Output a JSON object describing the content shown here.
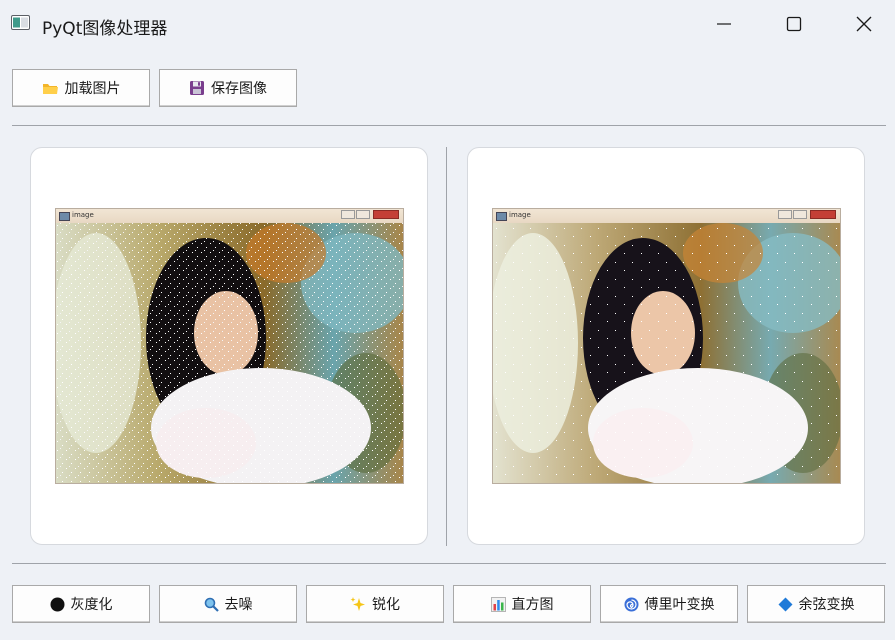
{
  "window": {
    "title": "PyQt图像处理器",
    "controls": [
      "minimize",
      "maximize",
      "close"
    ]
  },
  "toolbar_top": {
    "load_label": "加载图片",
    "load_icon": "folder-icon",
    "save_label": "保存图像",
    "save_icon": "floppy-disk-icon"
  },
  "panels": {
    "original": {
      "window_label": "image"
    },
    "processed": {
      "window_label": "image"
    }
  },
  "toolbar_bottom": [
    {
      "label": "灰度化",
      "icon": "black-circle-icon"
    },
    {
      "label": "去噪",
      "icon": "magnifier-icon"
    },
    {
      "label": "锐化",
      "icon": "sparkles-icon"
    },
    {
      "label": "直方图",
      "icon": "bar-chart-icon"
    },
    {
      "label": "傅里叶变换",
      "icon": "cyclone-icon"
    },
    {
      "label": "余弦变换",
      "icon": "blue-diamond-icon"
    }
  ]
}
